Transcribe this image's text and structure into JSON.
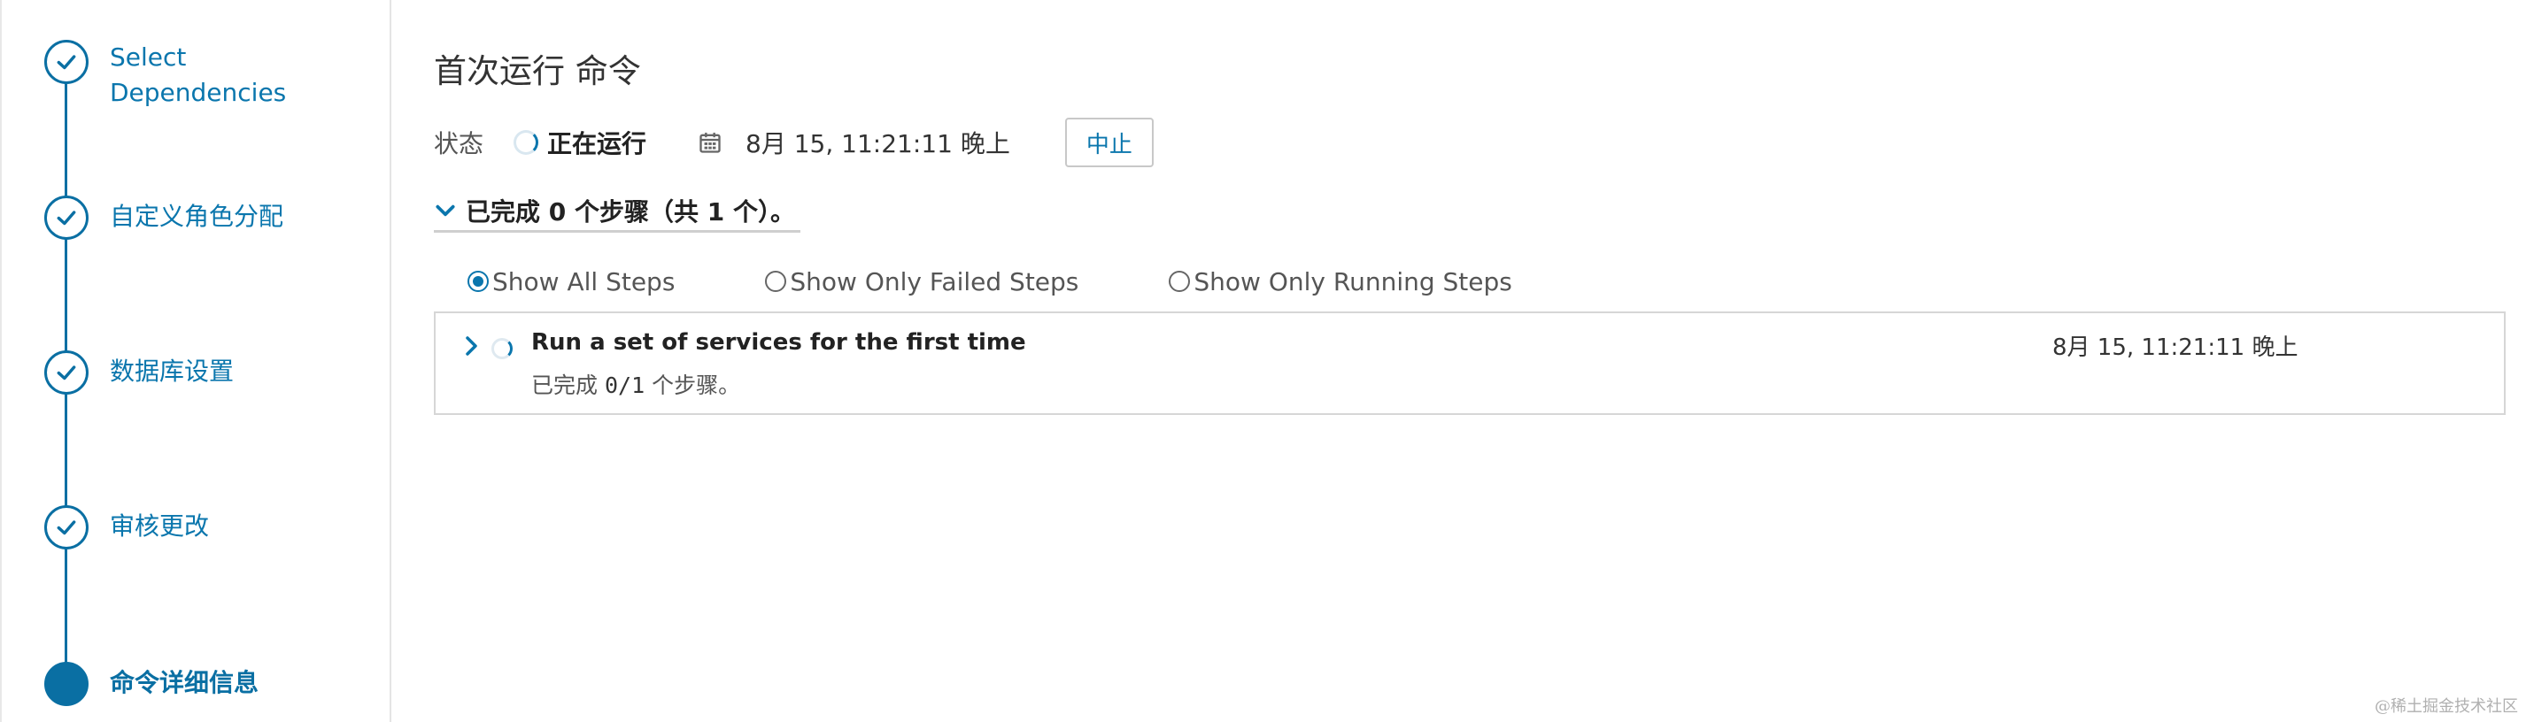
{
  "sidebar": {
    "steps": [
      {
        "label": "Select Dependencies",
        "state": "done"
      },
      {
        "label": "自定义角色分配",
        "state": "done"
      },
      {
        "label": "数据库设置",
        "state": "done"
      },
      {
        "label": "审核更改",
        "state": "done"
      },
      {
        "label": "命令详细信息",
        "state": "current"
      }
    ]
  },
  "main": {
    "title": "首次运行 命令",
    "status": {
      "label": "状态",
      "value": "正在运行",
      "time": "8月 15, 11:21:11 晚上",
      "abort_label": "中止"
    },
    "summary": "已完成 0 个步骤（共 1 个）。",
    "filters": [
      {
        "label": "Show All Steps",
        "checked": true
      },
      {
        "label": "Show Only Failed Steps",
        "checked": false
      },
      {
        "label": "Show Only Running Steps",
        "checked": false
      }
    ],
    "steps_table": [
      {
        "title": "Run a set of services for the first time",
        "time": "8月 15, 11:21:11 晚上",
        "sub_prefix": "已完成",
        "sub_count": "0/1",
        "sub_suffix": "个步骤。"
      }
    ]
  },
  "watermark": "@稀土掘金技术社区",
  "colors": {
    "accent": "#0a76ad",
    "step_line": "#0a6fa3",
    "border": "#d6d6d6"
  },
  "icons": {
    "step_done": "check-icon",
    "calendar": "calendar-icon",
    "collapse": "chevron-down-icon",
    "expand": "chevron-right-icon",
    "running": "spinner-icon"
  }
}
